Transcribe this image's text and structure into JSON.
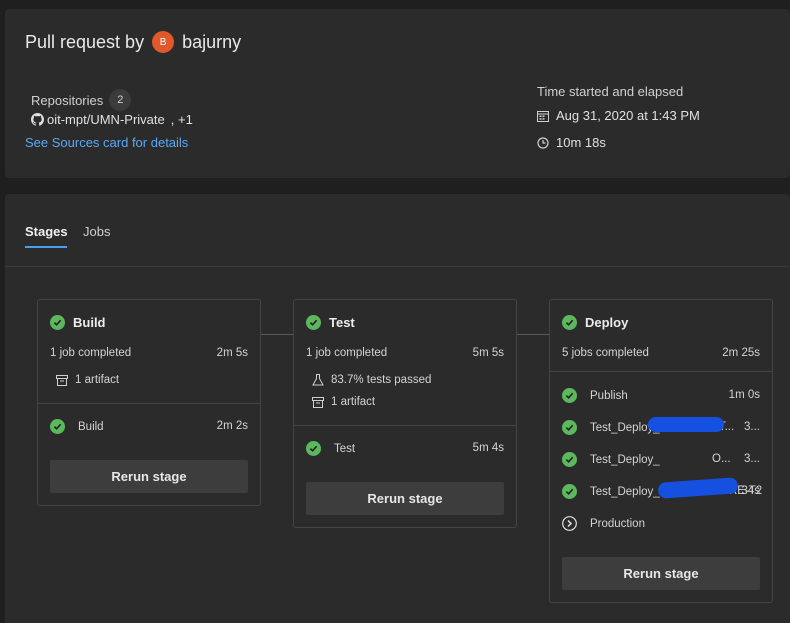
{
  "summary": {
    "title_prefix": "Pull request by",
    "avatar_initial": "B",
    "author": "bajurny",
    "repositories_label": "Repositories",
    "repositories_count": "2",
    "repo_name": "oit-mpt/UMN-Private",
    "repo_extra": ", +1",
    "sources_link": "See Sources card for details",
    "time_label": "Time started and elapsed",
    "started": "Aug 31, 2020 at 1:43 PM",
    "elapsed": "10m 18s"
  },
  "tabs": {
    "stages": "Stages",
    "jobs": "Jobs"
  },
  "stages": [
    {
      "name": "Build",
      "jobs_completed": "1 job completed",
      "duration": "2m 5s",
      "artifact": "1 artifact",
      "jobs": [
        {
          "name": "Build",
          "duration": "2m 2s"
        }
      ],
      "rerun": "Rerun stage"
    },
    {
      "name": "Test",
      "jobs_completed": "1 job completed",
      "duration": "5m 5s",
      "tests": "83.7% tests passed",
      "artifact": "1 artifact",
      "jobs": [
        {
          "name": "Test",
          "duration": "5m 4s"
        }
      ],
      "rerun": "Rerun stage"
    },
    {
      "name": "Deploy",
      "jobs_completed": "5 jobs completed",
      "duration": "2m 25s",
      "jobs": [
        {
          "name": "Publish",
          "duration": "1m 0s"
        },
        {
          "name": "Test_Deploy_",
          "suffix": "OLS-T...",
          "duration": "3..."
        },
        {
          "name": "Test_Deploy_",
          "suffix": "O...",
          "duration": "3..."
        },
        {
          "name": "Test_Deploy_",
          "suffix": "ORE-T2",
          "duration": "34s"
        },
        {
          "name": "Production",
          "duration": ""
        }
      ],
      "rerun": "Rerun stage"
    }
  ]
}
